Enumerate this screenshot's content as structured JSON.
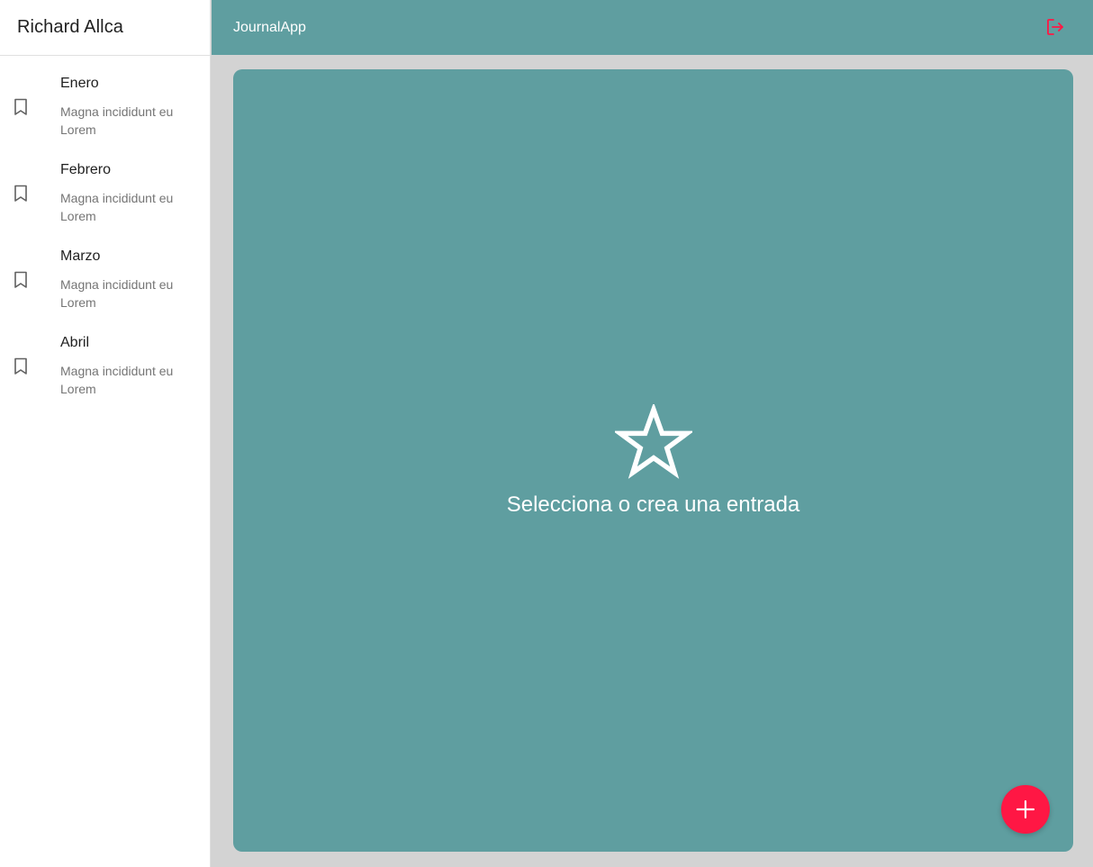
{
  "sidebar": {
    "user_name": "Richard Allca",
    "entries": [
      {
        "title": "Enero",
        "body": "Magna incididunt eu Lorem",
        "icon": "bookmark-icon"
      },
      {
        "title": "Febrero",
        "body": "Magna incididunt eu Lorem",
        "icon": "bookmark-icon"
      },
      {
        "title": "Marzo",
        "body": "Magna incididunt eu Lorem",
        "icon": "bookmark-icon"
      },
      {
        "title": "Abril",
        "body": "Magna incididunt eu Lorem",
        "icon": "bookmark-icon"
      }
    ]
  },
  "header": {
    "app_title": "JournalApp",
    "logout_icon": "logout-icon"
  },
  "main": {
    "empty_state_icon": "star-icon",
    "empty_state_text": "Selecciona o crea una entrada",
    "fab_icon": "add-icon"
  },
  "colors": {
    "primary": "#5f9ea0",
    "accent": "#ff1744",
    "background": "#d3d3d3",
    "sidebar": "#ffffff"
  }
}
